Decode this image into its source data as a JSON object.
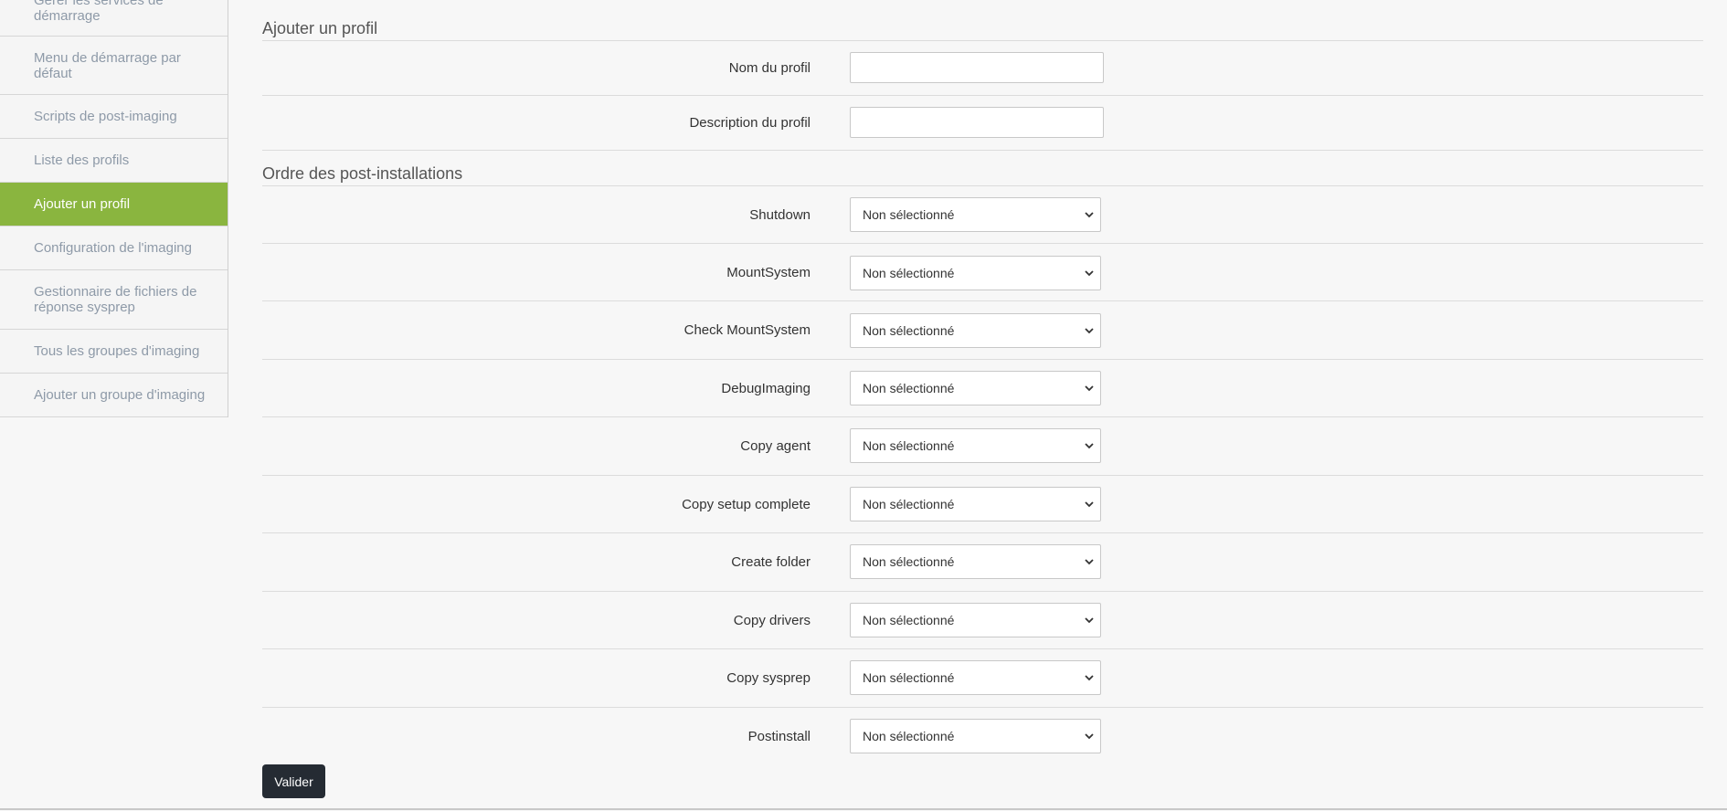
{
  "sidebar": {
    "items": [
      {
        "label": "Gérer les services de démarrage",
        "active": false
      },
      {
        "label": "Menu de démarrage par défaut",
        "active": false
      },
      {
        "label": "Scripts de post-imaging",
        "active": false
      },
      {
        "label": "Liste des profils",
        "active": false
      },
      {
        "label": "Ajouter un profil",
        "active": true
      },
      {
        "label": "Configuration de l'imaging",
        "active": false
      },
      {
        "label": "Gestionnaire de fichiers de réponse sysprep",
        "active": false
      },
      {
        "label": "Tous les groupes d'imaging",
        "active": false
      },
      {
        "label": "Ajouter un groupe d'imaging",
        "active": false
      }
    ]
  },
  "profile_section": {
    "title": "Ajouter un profil",
    "fields": [
      {
        "label": "Nom du profil",
        "value": ""
      },
      {
        "label": "Description du profil",
        "value": ""
      }
    ]
  },
  "postinstall_section": {
    "title": "Ordre des post-installations",
    "rows": [
      {
        "label": "Shutdown",
        "selected": "Non sélectionné"
      },
      {
        "label": "MountSystem",
        "selected": "Non sélectionné"
      },
      {
        "label": "Check MountSystem",
        "selected": "Non sélectionné"
      },
      {
        "label": "DebugImaging",
        "selected": "Non sélectionné"
      },
      {
        "label": "Copy agent",
        "selected": "Non sélectionné"
      },
      {
        "label": "Copy setup complete",
        "selected": "Non sélectionné"
      },
      {
        "label": "Create folder",
        "selected": "Non sélectionné"
      },
      {
        "label": "Copy drivers",
        "selected": "Non sélectionné"
      },
      {
        "label": "Copy sysprep",
        "selected": "Non sélectionné"
      },
      {
        "label": "Postinstall",
        "selected": "Non sélectionné"
      }
    ]
  },
  "submit_label": "Valider",
  "colors": {
    "active": "#8ab53f",
    "button": "#252b33"
  }
}
